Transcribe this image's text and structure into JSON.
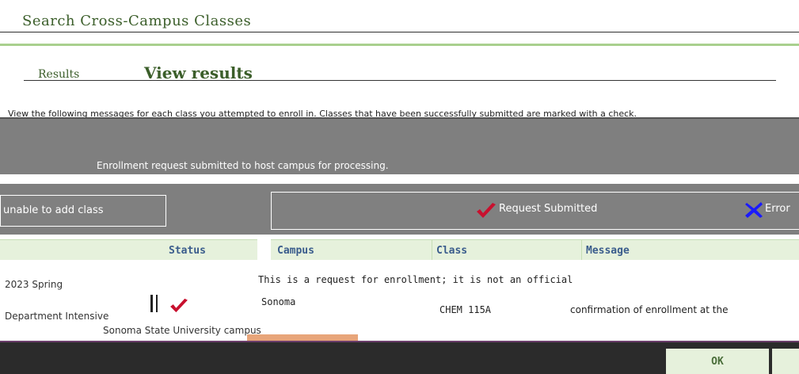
{
  "header": {
    "title": "Search Cross-Campus Classes",
    "section_prefix": "Results",
    "section_title": "View results",
    "instructions": "View the following messages for each class you attempted to enroll in. Classes that have been successfully submitted are marked with a check."
  },
  "info_band": {
    "text": "Enrollment request submitted to host campus for processing."
  },
  "legend": {
    "unable_label": "unable to add class",
    "submitted_label": "Request Submitted",
    "error_label": "Error"
  },
  "table": {
    "columns": [
      "Status",
      "Campus",
      "Class",
      "Message"
    ],
    "rows": [
      {
        "term": "2023 Spring",
        "left_text": "Sonoma State University",
        "left_text2": "Department Intensive",
        "status_icon": "check-icon",
        "campus": "Sonoma",
        "class": "CHEM 115A",
        "message": "This is a request for enrollment; it is not an official",
        "message2": "confirmation of enrollment at the",
        "university": "Sonoma State University campus"
      }
    ]
  },
  "footer": {
    "ok_label": "OK"
  },
  "colors": {
    "accent_green": "#a9d08e",
    "header_green": "#e6f1dc",
    "grey_band": "#7f7f7f",
    "check_red": "#c8102e",
    "error_blue": "#1a1aff",
    "footer_dark": "#2b2b2b"
  }
}
